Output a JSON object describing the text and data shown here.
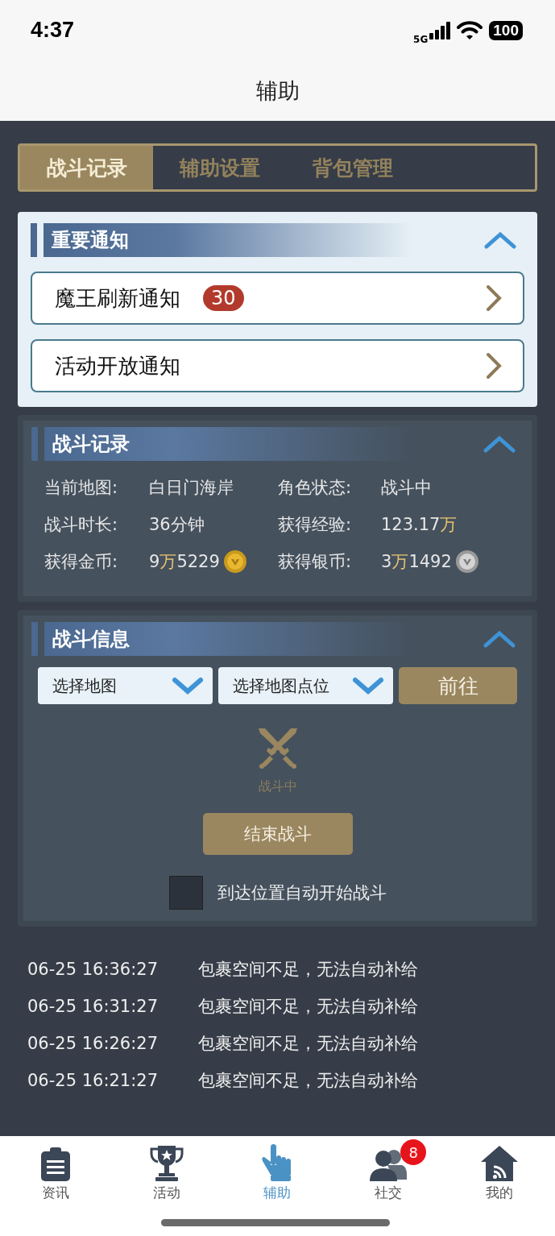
{
  "status_bar": {
    "time": "4:37",
    "network": "5G",
    "battery": "100"
  },
  "header": {
    "title": "辅助"
  },
  "tabs": [
    {
      "label": "战斗记录",
      "selected": true
    },
    {
      "label": "辅助设置",
      "selected": false
    },
    {
      "label": "背包管理",
      "selected": false
    }
  ],
  "notices": {
    "title": "重要通知",
    "expanded": true,
    "items": [
      {
        "label": "魔王刷新通知",
        "badge": "30"
      },
      {
        "label": "活动开放通知"
      }
    ]
  },
  "battle_record": {
    "title": "战斗记录",
    "expanded": true,
    "fields": [
      {
        "label": "当前地图:",
        "kind": "plain",
        "value": [
          {
            "text": "白日门海岸",
            "kind": "number"
          }
        ]
      },
      {
        "label": "角色状态:",
        "kind": "plain",
        "value": [
          {
            "text": "战斗中",
            "kind": "number"
          }
        ]
      },
      {
        "label": "战斗时长:",
        "kind": "plain",
        "value": [
          {
            "text": "36分钟",
            "kind": "number"
          }
        ]
      },
      {
        "label": "获得经验:",
        "kind": "plain",
        "value": [
          {
            "text": "123.17",
            "kind": "number"
          },
          {
            "text": "万",
            "kind": "unit"
          }
        ]
      },
      {
        "label": "获得金币:",
        "kind": "gold_coin",
        "value": [
          {
            "text": "9",
            "kind": "number"
          },
          {
            "text": "万",
            "kind": "unit"
          },
          {
            "text": "5229",
            "kind": "number"
          }
        ]
      },
      {
        "label": "获得银币:",
        "kind": "silver_coin",
        "value": [
          {
            "text": "3",
            "kind": "number"
          },
          {
            "text": "万",
            "kind": "unit"
          },
          {
            "text": "1492",
            "kind": "number"
          }
        ]
      }
    ]
  },
  "battle_info": {
    "title": "战斗信息",
    "expanded": true,
    "selects": [
      {
        "placeholder": "选择地图"
      },
      {
        "placeholder": "选择地图点位"
      }
    ],
    "go_button": "前往",
    "status": "战斗中",
    "end_button": "结束战斗",
    "auto_start": {
      "label": "到达位置自动开始战斗",
      "checked": false
    }
  },
  "log": [
    {
      "time": "06-25 16:36:27",
      "message": "包裹空间不足，无法自动补给"
    },
    {
      "time": "06-25 16:31:27",
      "message": "包裹空间不足，无法自动补给"
    },
    {
      "time": "06-25 16:26:27",
      "message": "包裹空间不足，无法自动补给"
    },
    {
      "time": "06-25 16:21:27",
      "message": "包裹空间不足，无法自动补给"
    }
  ],
  "tab_bar": [
    {
      "label": "资讯",
      "selected": false
    },
    {
      "label": "活动",
      "selected": false
    },
    {
      "label": "辅助",
      "selected": true
    },
    {
      "label": "社交",
      "selected": false,
      "badge": "8"
    },
    {
      "label": "我的",
      "selected": false
    }
  ]
}
